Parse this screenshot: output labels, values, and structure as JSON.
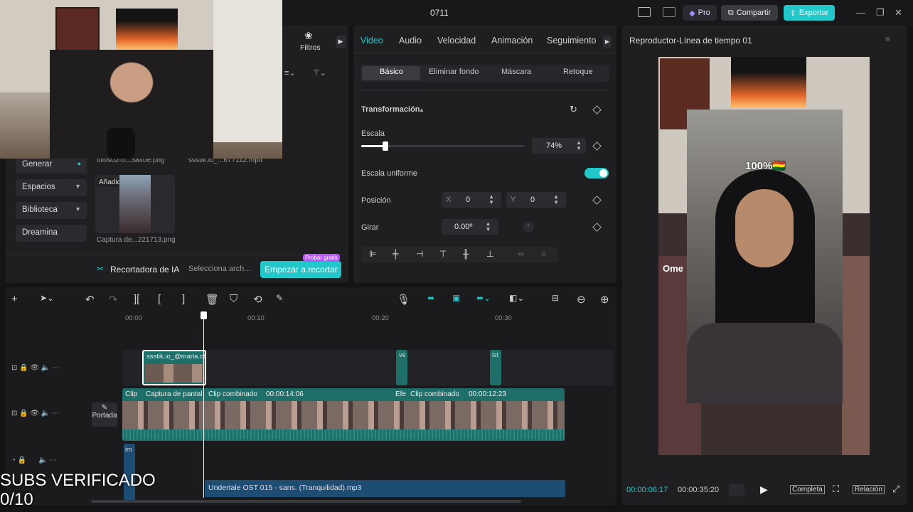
{
  "topbar": {
    "title": "0711",
    "pro": "Pro",
    "share": "Compartir",
    "export": "Exportar"
  },
  "media": {
    "filtros": "Filtros",
    "file_top_left": "olivs02-0...3a40e.png",
    "file_top_right": "ssstik.io_...677112.mp4",
    "sidebar": [
      {
        "label": "Generar"
      },
      {
        "label": "Espacios"
      },
      {
        "label": "Biblioteca"
      },
      {
        "label": "Dreamina"
      }
    ],
    "added_badge": "Añadido",
    "thumb_caption": "Captura de...221713.png",
    "cutter_label": "Recortadora de IA",
    "cutter_select": "Selecciona arch...",
    "cutter_button": "Empezar a recortar",
    "cutter_badge": "Probar gratis"
  },
  "props": {
    "tabs": [
      "Video",
      "Audio",
      "Velocidad",
      "Animación",
      "Seguimiento"
    ],
    "subtabs": [
      "Básico",
      "Eliminar fondo",
      "Máscara",
      "Retoque"
    ],
    "transform": "Transformación",
    "scale_label": "Escala",
    "scale_value": "74%",
    "scale_level": 0.74,
    "uniform_label": "Escala uniforme",
    "position_label": "Posición",
    "x_label": "X",
    "x_value": "0",
    "y_label": "Y",
    "y_value": "0",
    "rotate_label": "Girar",
    "rotate_value": "0.00º"
  },
  "timeline": {
    "ruler": [
      "00:00",
      "00:10",
      "00:20",
      "00:30"
    ],
    "clip1": "ssstik.io_@maria.ct",
    "clip_ve": "ve",
    "clip_ist": "ist",
    "main_labels": [
      "Clip",
      "Captura de pantal",
      "Clip combinado",
      "00:00:14:06",
      "Efe",
      "Clip combinado",
      "00:00:12:23"
    ],
    "cover": "Portada",
    "im_clip": "im",
    "audio": "Undertale OST 015 - sans. (Tranquilidad).mp3"
  },
  "player": {
    "title": "Reproductor-Línea de tiempo 01",
    "current": "00:00:06:17",
    "total": "00:00:35:20",
    "full": "Completa",
    "ratio": "Relación",
    "overlay_text": "100%🇧🇴",
    "ome": "Ome"
  },
  "subs": {
    "line1": "SUBS VERIFICADO",
    "line2": "0/10"
  }
}
